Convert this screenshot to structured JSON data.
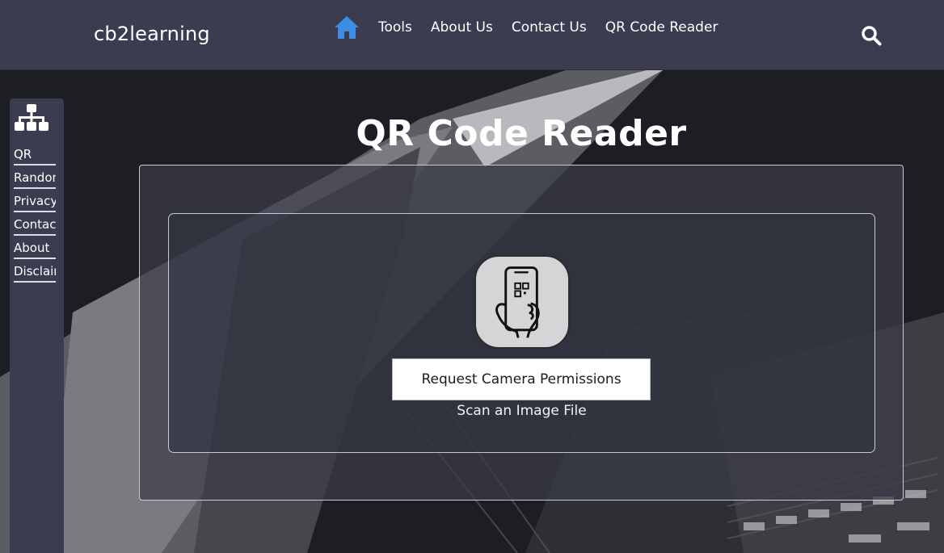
{
  "header": {
    "brand": "cb2learning",
    "nav": [
      {
        "label": "Tools"
      },
      {
        "label": "About Us"
      },
      {
        "label": "Contact Us"
      },
      {
        "label": "QR Code Reader"
      }
    ],
    "icons": {
      "home": "home-icon",
      "search": "search-icon"
    },
    "accent_color": "#3b8de6"
  },
  "sidebar": {
    "icon": "sitemap-icon",
    "items": [
      {
        "label": "QR"
      },
      {
        "label": "Random"
      },
      {
        "label": "Privacy"
      },
      {
        "label": "Contact"
      },
      {
        "label": "About"
      },
      {
        "label": "Disclaimer"
      }
    ]
  },
  "main": {
    "title": "QR Code Reader",
    "scanner_icon": "phone-qr-scan-icon",
    "camera_button": "Request Camera Permissions",
    "file_link": "Scan an Image File"
  }
}
